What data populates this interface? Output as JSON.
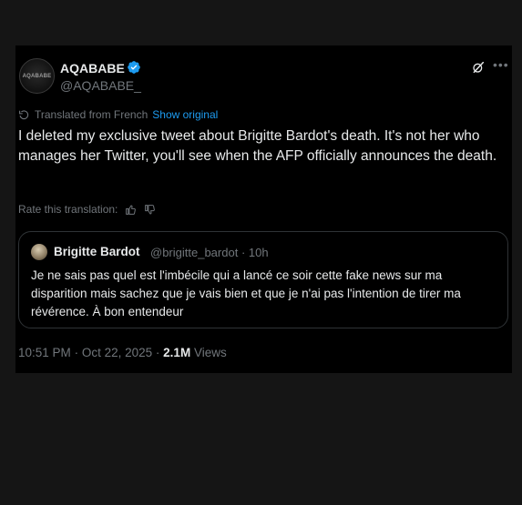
{
  "author": {
    "avatar_text": "AQABABE",
    "display_name": "AQABABE",
    "handle": "@AQABABE_"
  },
  "translation": {
    "translated_from": "Translated from French",
    "show_original": "Show original"
  },
  "tweet_text": "I deleted my exclusive tweet about Brigitte Bardot's death. It's not her who manages her Twitter, you'll see when the AFP officially announces the death.",
  "rate_translation": "Rate this translation:",
  "quoted": {
    "display_name": "Brigitte Bardot",
    "handle": "@brigitte_bardot",
    "separator": "·",
    "time_ago": "10h",
    "text": "Je ne sais pas quel est l'imbécile qui a  lancé ce soir cette fake news sur ma disparition mais sachez que je vais bien et que je n'ai pas l'intention de tirer ma révérence. À bon entendeur"
  },
  "meta": {
    "time": "10:51 PM",
    "date_sep": "·",
    "date": "Oct 22, 2025",
    "views_sep": "·",
    "views_count": "2.1M",
    "views_label": "Views"
  },
  "colors": {
    "accent": "#1d9bf0",
    "muted": "#71767b",
    "background": "#000000"
  }
}
